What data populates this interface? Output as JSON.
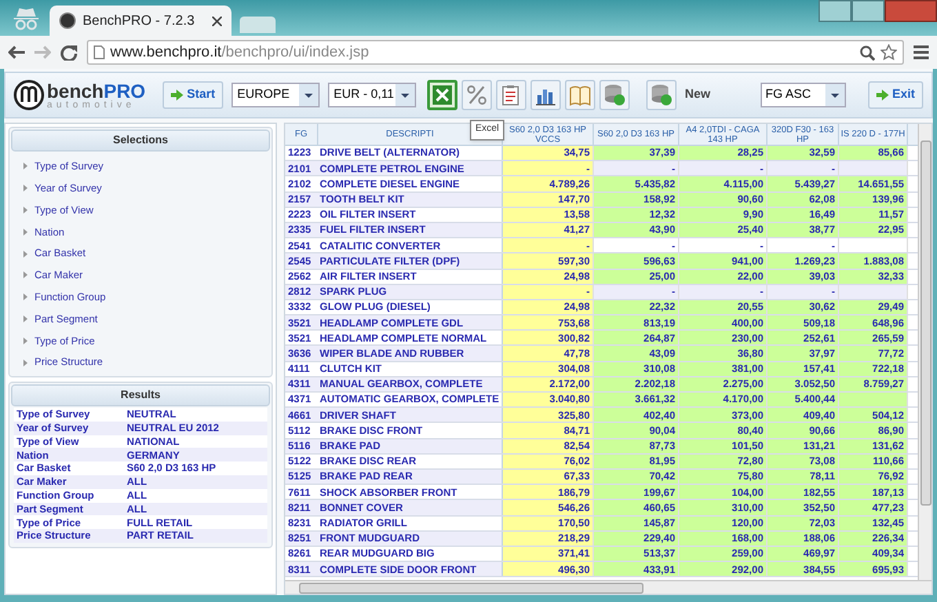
{
  "browser": {
    "tab_title": "BenchPRO - 7.2.3",
    "url_host": "www.benchpro.it",
    "url_path": "/benchpro/ui/index.jsp"
  },
  "toolbar": {
    "logo_main": "bench",
    "logo_accent": "PRO",
    "logo_sub": "automotive",
    "start": "Start",
    "region": "EUROPE",
    "currency": "EUR - 0,11",
    "tools": [
      {
        "kind": "excel",
        "selected": true
      },
      {
        "kind": "percent",
        "selected": false
      },
      {
        "kind": "checklist",
        "selected": false
      },
      {
        "kind": "chart",
        "selected": false
      },
      {
        "kind": "book",
        "selected": false
      },
      {
        "kind": "database",
        "selected": false
      }
    ],
    "new_label": "New",
    "sort": "FG ASC",
    "exit": "Exit",
    "tooltip": "Excel"
  },
  "selections": {
    "title": "Selections",
    "items": [
      "Type of Survey",
      "Year of Survey",
      "Type of View",
      "Nation",
      "Car Basket",
      "Car Maker",
      "Function Group",
      "Part Segment",
      "Type of Price",
      "Price Structure"
    ]
  },
  "results": {
    "title": "Results",
    "rows": [
      {
        "label": "Type of Survey",
        "value": "NEUTRAL"
      },
      {
        "label": "Year of Survey",
        "value": "NEUTRAL EU 2012"
      },
      {
        "label": "Type of View",
        "value": "NATIONAL"
      },
      {
        "label": "Nation",
        "value": "GERMANY"
      },
      {
        "label": "Car Basket",
        "value": "S60 2,0 D3 163 HP"
      },
      {
        "label": "Car Maker",
        "value": "ALL"
      },
      {
        "label": "Function Group",
        "value": "ALL"
      },
      {
        "label": "Part Segment",
        "value": "ALL"
      },
      {
        "label": "Type of Price",
        "value": "FULL RETAIL"
      },
      {
        "label": "Price Structure",
        "value": "PART RETAIL"
      }
    ]
  },
  "table": {
    "columns": [
      "FG",
      "DESCRIPTI",
      "S60 2,0 D3 163 HP VCCS",
      "S60 2,0 D3 163 HP",
      "A4 2,0TDI - CAGA 143 HP",
      "320D F30 - 163 HP",
      "IS 220 D - 177H"
    ],
    "rows": [
      {
        "fg": "1223",
        "description": "DRIVE BELT (ALTERNATOR)",
        "kind": "priced",
        "values": [
          "34,75",
          "37,39",
          "28,25",
          "32,59",
          "85,66"
        ]
      },
      {
        "fg": "2101",
        "description": "COMPLETE PETROL ENGINE",
        "kind": "missing",
        "values": [
          "-",
          "-",
          "-",
          "-"
        ]
      },
      {
        "fg": "2102",
        "description": "COMPLETE DIESEL ENGINE",
        "kind": "priced",
        "values": [
          "4.789,26",
          "5.435,82",
          "4.115,00",
          "5.439,27",
          "14.651,55"
        ]
      },
      {
        "fg": "2157",
        "description": "TOOTH BELT KIT",
        "kind": "priced",
        "values": [
          "147,70",
          "158,92",
          "90,60",
          "62,08",
          "139,96"
        ]
      },
      {
        "fg": "2223",
        "description": "OIL FILTER INSERT",
        "kind": "priced",
        "values": [
          "13,58",
          "12,32",
          "9,90",
          "16,49",
          "11,57"
        ]
      },
      {
        "fg": "2335",
        "description": "FUEL FILTER INSERT",
        "kind": "priced",
        "values": [
          "41,27",
          "43,90",
          "25,40",
          "38,77",
          "22,95"
        ]
      },
      {
        "fg": "2541",
        "description": "CATALITIC CONVERTER",
        "kind": "missing",
        "values": [
          "-",
          "-",
          "-",
          "-"
        ]
      },
      {
        "fg": "2545",
        "description": "PARTICULATE FILTER (DPF)",
        "kind": "priced",
        "values": [
          "597,30",
          "596,63",
          "941,00",
          "1.269,23",
          "1.883,08"
        ]
      },
      {
        "fg": "2562",
        "description": "AIR FILTER INSERT",
        "kind": "priced",
        "values": [
          "24,98",
          "25,00",
          "22,00",
          "39,03",
          "32,33"
        ]
      },
      {
        "fg": "2812",
        "description": "SPARK PLUG",
        "kind": "missing",
        "values": [
          "-",
          "-",
          "-",
          "-"
        ]
      },
      {
        "fg": "3332",
        "description": "GLOW PLUG (DIESEL)",
        "kind": "priced",
        "values": [
          "24,98",
          "22,32",
          "20,55",
          "30,62",
          "29,49"
        ]
      },
      {
        "fg": "3521",
        "description": "HEADLAMP COMPLETE GDL",
        "kind": "priced",
        "values": [
          "753,68",
          "813,19",
          "400,00",
          "509,18",
          "648,96"
        ]
      },
      {
        "fg": "3521",
        "description": "HEADLAMP COMPLETE NORMAL",
        "kind": "priced",
        "values": [
          "300,82",
          "264,87",
          "230,00",
          "252,61",
          "265,59"
        ]
      },
      {
        "fg": "3636",
        "description": "WIPER BLADE AND RUBBER",
        "kind": "priced",
        "values": [
          "47,78",
          "43,09",
          "36,80",
          "37,97",
          "77,72"
        ]
      },
      {
        "fg": "4111",
        "description": "CLUTCH KIT",
        "kind": "priced",
        "values": [
          "304,08",
          "310,08",
          "381,00",
          "157,41",
          "722,18"
        ]
      },
      {
        "fg": "4311",
        "description": "MANUAL GEARBOX, COMPLETE",
        "kind": "priced",
        "values": [
          "2.172,00",
          "2.202,18",
          "2.275,00",
          "3.052,50",
          "8.759,27"
        ]
      },
      {
        "fg": "4371",
        "description": "AUTOMATIC GEARBOX, COMPLETE",
        "kind": "priced",
        "values": [
          "3.040,80",
          "3.661,32",
          "4.170,00",
          "5.400,44"
        ]
      },
      {
        "fg": "4661",
        "description": "DRIVER SHAFT",
        "kind": "priced",
        "values": [
          "325,80",
          "402,40",
          "373,00",
          "409,40",
          "504,12"
        ]
      },
      {
        "fg": "5112",
        "description": "BRAKE DISC FRONT",
        "kind": "priced",
        "values": [
          "84,71",
          "90,04",
          "80,40",
          "90,66",
          "86,90"
        ]
      },
      {
        "fg": "5116",
        "description": "BRAKE PAD",
        "kind": "priced",
        "values": [
          "82,54",
          "87,73",
          "101,50",
          "131,21",
          "131,62"
        ]
      },
      {
        "fg": "5122",
        "description": "BRAKE DISC REAR",
        "kind": "priced",
        "values": [
          "76,02",
          "81,95",
          "72,80",
          "73,08",
          "110,66"
        ]
      },
      {
        "fg": "5125",
        "description": "BRAKE PAD REAR",
        "kind": "priced",
        "values": [
          "67,33",
          "70,42",
          "75,80",
          "78,11",
          "76,92"
        ]
      },
      {
        "fg": "7611",
        "description": "SHOCK ABSORBER FRONT",
        "kind": "priced",
        "values": [
          "186,79",
          "199,67",
          "104,00",
          "182,55",
          "187,13"
        ]
      },
      {
        "fg": "8211",
        "description": "BONNET COVER",
        "kind": "priced",
        "values": [
          "546,26",
          "460,65",
          "310,00",
          "352,50",
          "477,23"
        ]
      },
      {
        "fg": "8231",
        "description": "RADIATOR GRILL",
        "kind": "priced",
        "values": [
          "170,50",
          "145,87",
          "120,00",
          "72,03",
          "132,45"
        ]
      },
      {
        "fg": "8251",
        "description": "FRONT MUDGUARD",
        "kind": "priced",
        "values": [
          "218,29",
          "229,40",
          "168,00",
          "188,06",
          "226,34"
        ]
      },
      {
        "fg": "8261",
        "description": "REAR MUDGUARD BIG",
        "kind": "priced",
        "values": [
          "371,41",
          "513,37",
          "259,00",
          "469,97",
          "409,34"
        ]
      },
      {
        "fg": "8311",
        "description": "COMPLETE SIDE DOOR FRONT",
        "kind": "priced",
        "values": [
          "496,30",
          "433,91",
          "292,00",
          "384,55",
          "695,93"
        ]
      }
    ]
  }
}
